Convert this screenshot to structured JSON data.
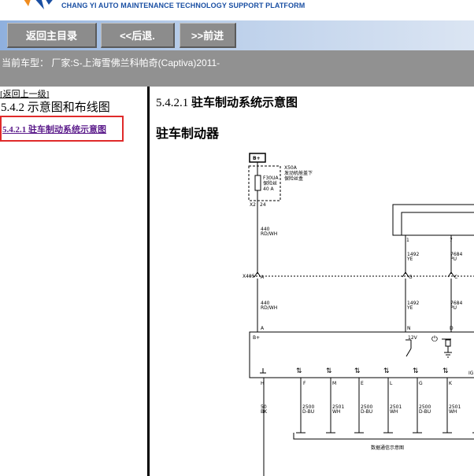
{
  "header": {
    "platform_title": "CHANG YI AUTO MAINTENANCE TECHNOLOGY SUPPORT PLATFORM"
  },
  "toolbar": {
    "home_label": "返回主目录",
    "back_label": "<<后退.",
    "forward_label": ">>前进"
  },
  "model_bar": {
    "text": "当前车型：  厂家:S-上海雪佛兰科帕奇(Captiva)2011-"
  },
  "left_pane": {
    "back_link": "[返回上一级]",
    "section_title": "5.4.2 示意图和布线图",
    "active_link": "5.4.2.1 驻车制动系统示意图"
  },
  "content": {
    "heading_number": "5.4.2.1 ",
    "heading_text": "驻车制动系统示意图",
    "subheading": "驻车制动器"
  },
  "diagram": {
    "power_label": "B+",
    "fuse_box_id": "X50A",
    "fuse_box_name_1": "发动机舱盖下",
    "fuse_box_name_2": "保险丝盒",
    "fuse_id": "F30UA",
    "fuse_name": "保险丝",
    "fuse_rating": "40 A",
    "fuse_conn": "X2",
    "fuse_pin": "24",
    "wire_power": {
      "circuit": "440",
      "color": "RD/WH"
    },
    "connector_x405": "X405",
    "pin_a": "A",
    "pin_g": "G",
    "pin_c": "C",
    "wire_ye": {
      "circuit": "1492",
      "color": "YE"
    },
    "wire_pu": {
      "circuit": "7684",
      "color": "PU"
    },
    "upper_pin_1": "1",
    "upper_pin_7": "7",
    "module_pin_a": "A",
    "module_pin_n": "N",
    "module_pin_d": "D",
    "module_bplus": "B+",
    "volts": "12V",
    "ig_label": "IG",
    "bottom_pins": [
      "H",
      "F",
      "M",
      "E",
      "L",
      "G",
      "K"
    ],
    "bottom_wires": [
      {
        "circuit": "50",
        "color": "BK"
      },
      {
        "circuit": "2500",
        "color": "D-BU"
      },
      {
        "circuit": "2501",
        "color": "WH"
      },
      {
        "circuit": "2500",
        "color": "D-BU"
      },
      {
        "circuit": "2501",
        "color": "WH"
      },
      {
        "circuit": "2500",
        "color": "D-BU"
      },
      {
        "circuit": "2501",
        "color": "WH"
      }
    ],
    "bus_label": "数据通信示意图"
  }
}
